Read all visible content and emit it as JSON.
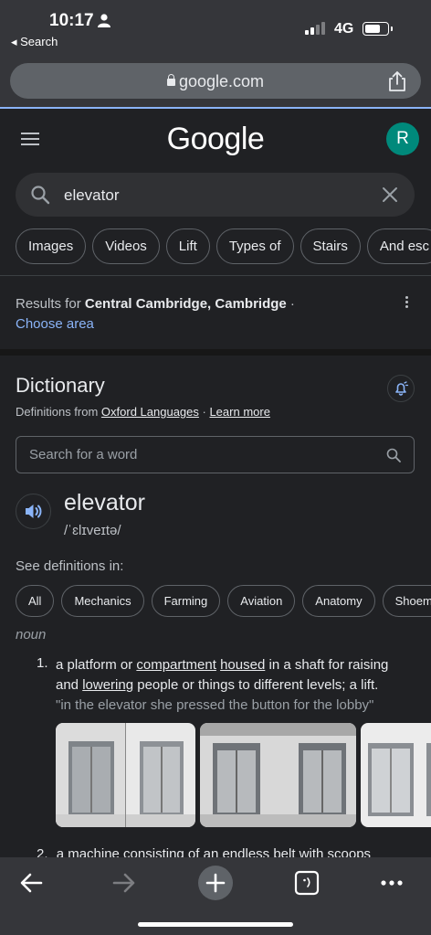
{
  "status_bar": {
    "time": "10:17",
    "back_app": "◂ Search",
    "network": "4G",
    "signal_bars": 2
  },
  "address_bar": {
    "url": "google.com"
  },
  "header": {
    "logo": "Google",
    "avatar_initial": "R",
    "avatar_color": "#00897b"
  },
  "search": {
    "query": "elevator"
  },
  "filter_chips": [
    "Images",
    "Videos",
    "Lift",
    "Types of",
    "Stairs",
    "And esc"
  ],
  "location": {
    "prefix": "Results for ",
    "place": "Central Cambridge, Cambridge",
    "suffix": " ·",
    "choose_area": "Choose area"
  },
  "dictionary": {
    "title": "Dictionary",
    "source_prefix": "Definitions from ",
    "source": "Oxford Languages",
    "separator": " · ",
    "learn_more": "Learn more",
    "search_placeholder": "Search for a word",
    "word": "elevator",
    "phonetic": "/ˈɛlɪveɪtə/",
    "see_definitions": "See definitions in:",
    "categories": [
      "All",
      "Mechanics",
      "Farming",
      "Aviation",
      "Anatomy",
      "Shoema"
    ],
    "part_of_speech": "noun",
    "senses": [
      {
        "number": "1.",
        "text_1": "a platform or ",
        "link_1": "compartment",
        "text_2": " ",
        "link_2": "housed",
        "text_3": " in a shaft for raising and ",
        "link_3": "lowering",
        "text_4": " people or things to different levels; a lift.",
        "example": "\"in the elevator she pressed the button for the lobby\""
      },
      {
        "number": "2.",
        "text": "a machine consisting of an endless belt with scoops"
      }
    ]
  },
  "colors": {
    "background": "#202124",
    "chrome": "#35363a",
    "link": "#8ab4f8",
    "text": "#e8eaed",
    "muted": "#9aa0a6"
  }
}
